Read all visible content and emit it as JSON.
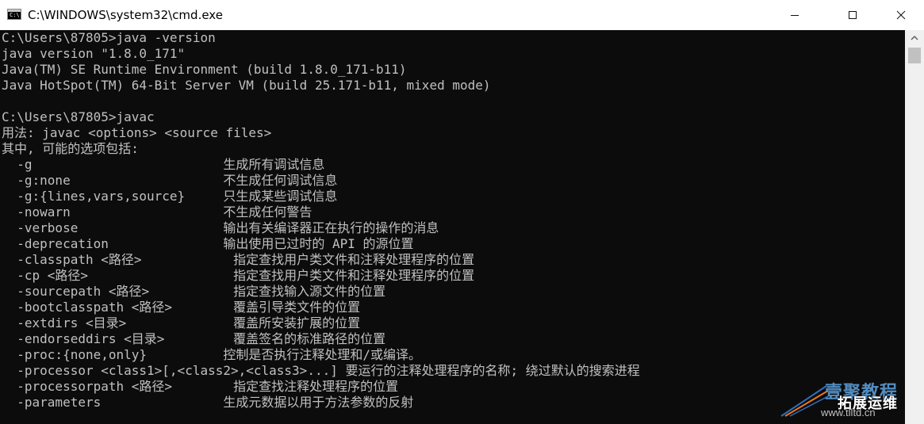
{
  "window": {
    "title": "C:\\WINDOWS\\system32\\cmd.exe",
    "icon_prompt": "C:\\",
    "colors": {
      "terminal_bg": "#0c0c0c",
      "terminal_fg": "#c0c0c0"
    }
  },
  "terminal": {
    "lines": [
      "C:\\Users\\87805>java -version",
      "java version \"1.8.0_171\"",
      "Java(TM) SE Runtime Environment (build 1.8.0_171-b11)",
      "Java HotSpot(TM) 64-Bit Server VM (build 25.171-b11, mixed mode)",
      "",
      "C:\\Users\\87805>javac",
      "用法: javac <options> <source files>",
      "其中, 可能的选项包括:",
      "  -g                         生成所有调试信息",
      "  -g:none                    不生成任何调试信息",
      "  -g:{lines,vars,source}     只生成某些调试信息",
      "  -nowarn                    不生成任何警告",
      "  -verbose                   输出有关编译器正在执行的操作的消息",
      "  -deprecation               输出使用已过时的 API 的源位置",
      "  -classpath <路径>            指定查找用户类文件和注释处理程序的位置",
      "  -cp <路径>                   指定查找用户类文件和注释处理程序的位置",
      "  -sourcepath <路径>           指定查找输入源文件的位置",
      "  -bootclasspath <路径>        覆盖引导类文件的位置",
      "  -extdirs <目录>              覆盖所安装扩展的位置",
      "  -endorseddirs <目录>         覆盖签名的标准路径的位置",
      "  -proc:{none,only}          控制是否执行注释处理和/或编译。",
      "  -processor <class1>[,<class2>,<class3>...] 要运行的注释处理程序的名称; 绕过默认的搜索进程",
      "  -processorpath <路径>        指定查找注释处理程序的位置",
      "  -parameters                生成元数据以用于方法参数的反射"
    ]
  },
  "watermark": {
    "brand": "壹聚教程",
    "sub": "拓展运维",
    "url": "www.tlltd.cn"
  }
}
